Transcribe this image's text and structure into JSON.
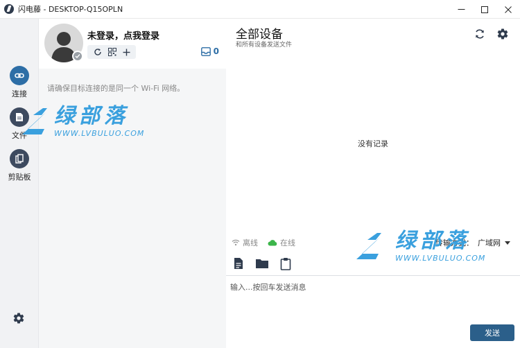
{
  "window": {
    "title": "闪电藤 - DESKTOP-Q15OPLN"
  },
  "rail": {
    "items": [
      {
        "label": "连接",
        "icon": "link-icon"
      },
      {
        "label": "文件",
        "icon": "file-icon"
      },
      {
        "label": "剪贴板",
        "icon": "clipboard-icon"
      }
    ]
  },
  "user": {
    "name": "未登录，点我登录",
    "inbox_count": "0"
  },
  "hint": {
    "wifi": "请确保目标连接的是同一个 Wi-Fi 网络。"
  },
  "main": {
    "title": "全部设备",
    "subtitle": "和所有设备发送文件",
    "empty": "没有记录"
  },
  "status": {
    "offline": "离线",
    "online": "在线"
  },
  "transfer": {
    "label": "传输方式：",
    "value": "广域网"
  },
  "composer": {
    "placeholder": "输入...按回车发送消息",
    "send_label": "发送"
  },
  "watermark": {
    "cn": "绿部落",
    "en": "WWW.LVBULUO.COM"
  },
  "colors": {
    "accent": "#2d6ea6",
    "send": "#2b5f8a",
    "online": "#3cb54a",
    "watermark": "#3aa0de"
  }
}
